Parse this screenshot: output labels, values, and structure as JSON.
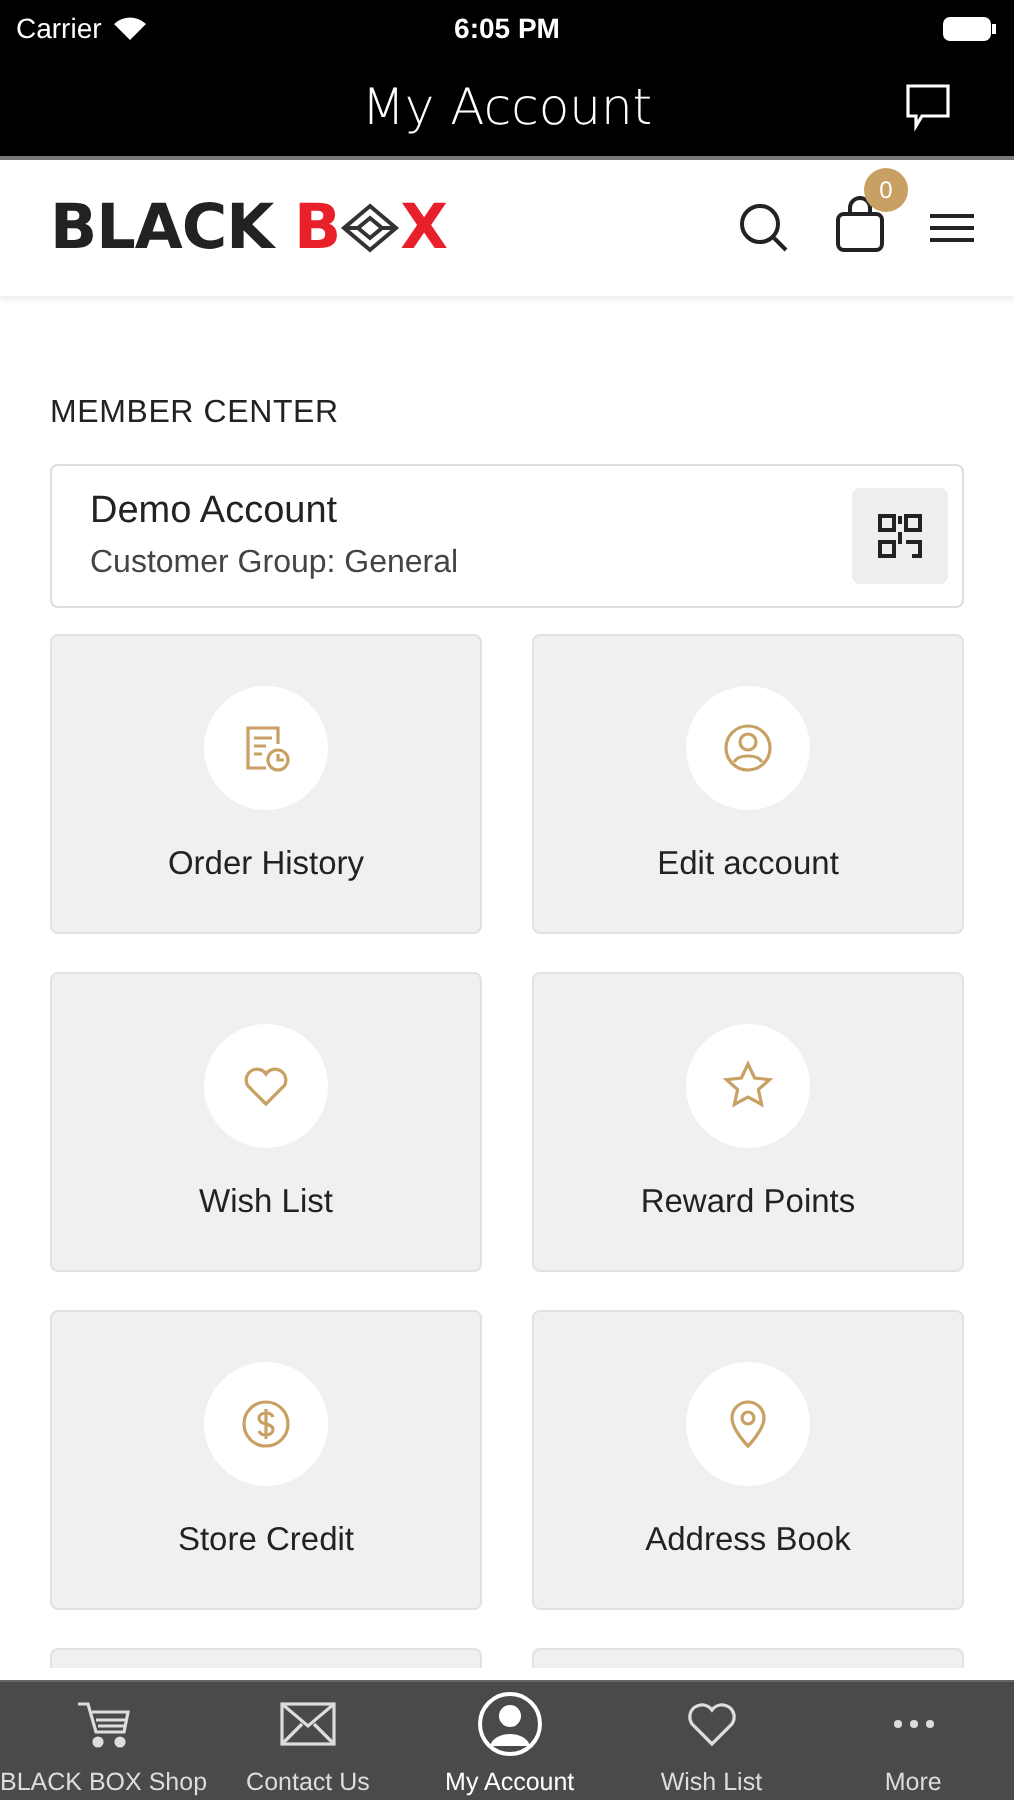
{
  "status_bar": {
    "carrier": "Carrier",
    "time": "6:05 PM"
  },
  "nav_bar": {
    "title": "My Account"
  },
  "header": {
    "logo": {
      "dark": "BLACK",
      "red_start": "B",
      "red_end": "X"
    },
    "cart_count": "0"
  },
  "member_center": {
    "heading": "MEMBER CENTER",
    "account_name": "Demo Account",
    "customer_group": "Customer Group: General"
  },
  "tiles": [
    {
      "kind": "tile",
      "label": "Order History"
    },
    {
      "kind": "tile",
      "label": "Edit account"
    },
    {
      "kind": "tile",
      "label": "Wish List"
    },
    {
      "kind": "tile",
      "label": "Reward Points"
    },
    {
      "kind": "tile",
      "label": "Store Credit"
    },
    {
      "kind": "tile",
      "label": "Address Book"
    },
    {
      "kind": "cut"
    },
    {
      "kind": "cut"
    }
  ],
  "tab_bar": [
    {
      "label": "BLACK BOX Shop",
      "selected": false
    },
    {
      "label": "Contact Us",
      "selected": false
    },
    {
      "label": "My Account",
      "selected": true
    },
    {
      "label": "Wish List",
      "selected": false
    },
    {
      "label": "More",
      "selected": false
    }
  ]
}
